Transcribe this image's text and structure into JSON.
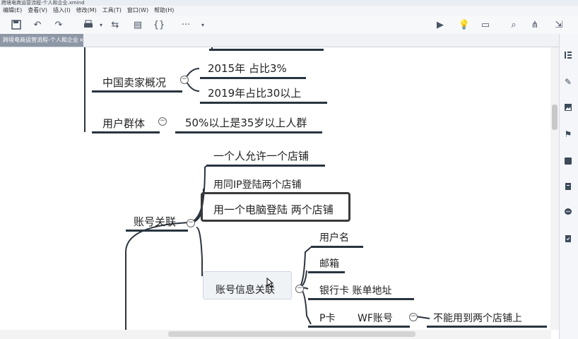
{
  "window": {
    "title": "跨境电商运营流程-个人和企业.xmind"
  },
  "menu": [
    "编辑(E)",
    "查看(V)",
    "插入(I)",
    "修改(M)",
    "工具(T)",
    "窗口(W)",
    "帮助(H)"
  ],
  "tab": {
    "label": "跨境电商运营流程-个人和企业"
  },
  "toolbar": {
    "more_label": "···"
  },
  "map": {
    "china_sellers": {
      "label": "中国卖家概况",
      "children": [
        "2015年 占比3%",
        "2019年占比30以上"
      ]
    },
    "user_group": {
      "label": "用户群体",
      "child": "50%以上是35岁以上人群"
    },
    "account_link": {
      "label": "账号关联",
      "children": [
        "一个人允许一个店铺",
        "用同IP登陆两个店铺",
        "用一个电脑登陆 两个店铺"
      ]
    },
    "account_info": {
      "label": "账号信息关联",
      "children": [
        "用户名",
        "邮箱",
        "银行卡  账单地址",
        "P卡"
      ],
      "wf": "WF账号",
      "wf_child": "不能用到两个店铺上"
    }
  },
  "colors": {
    "branch_line": "#2b3540",
    "selected_border": "#3a3a3a",
    "tab_bg": "#8d97a6"
  }
}
